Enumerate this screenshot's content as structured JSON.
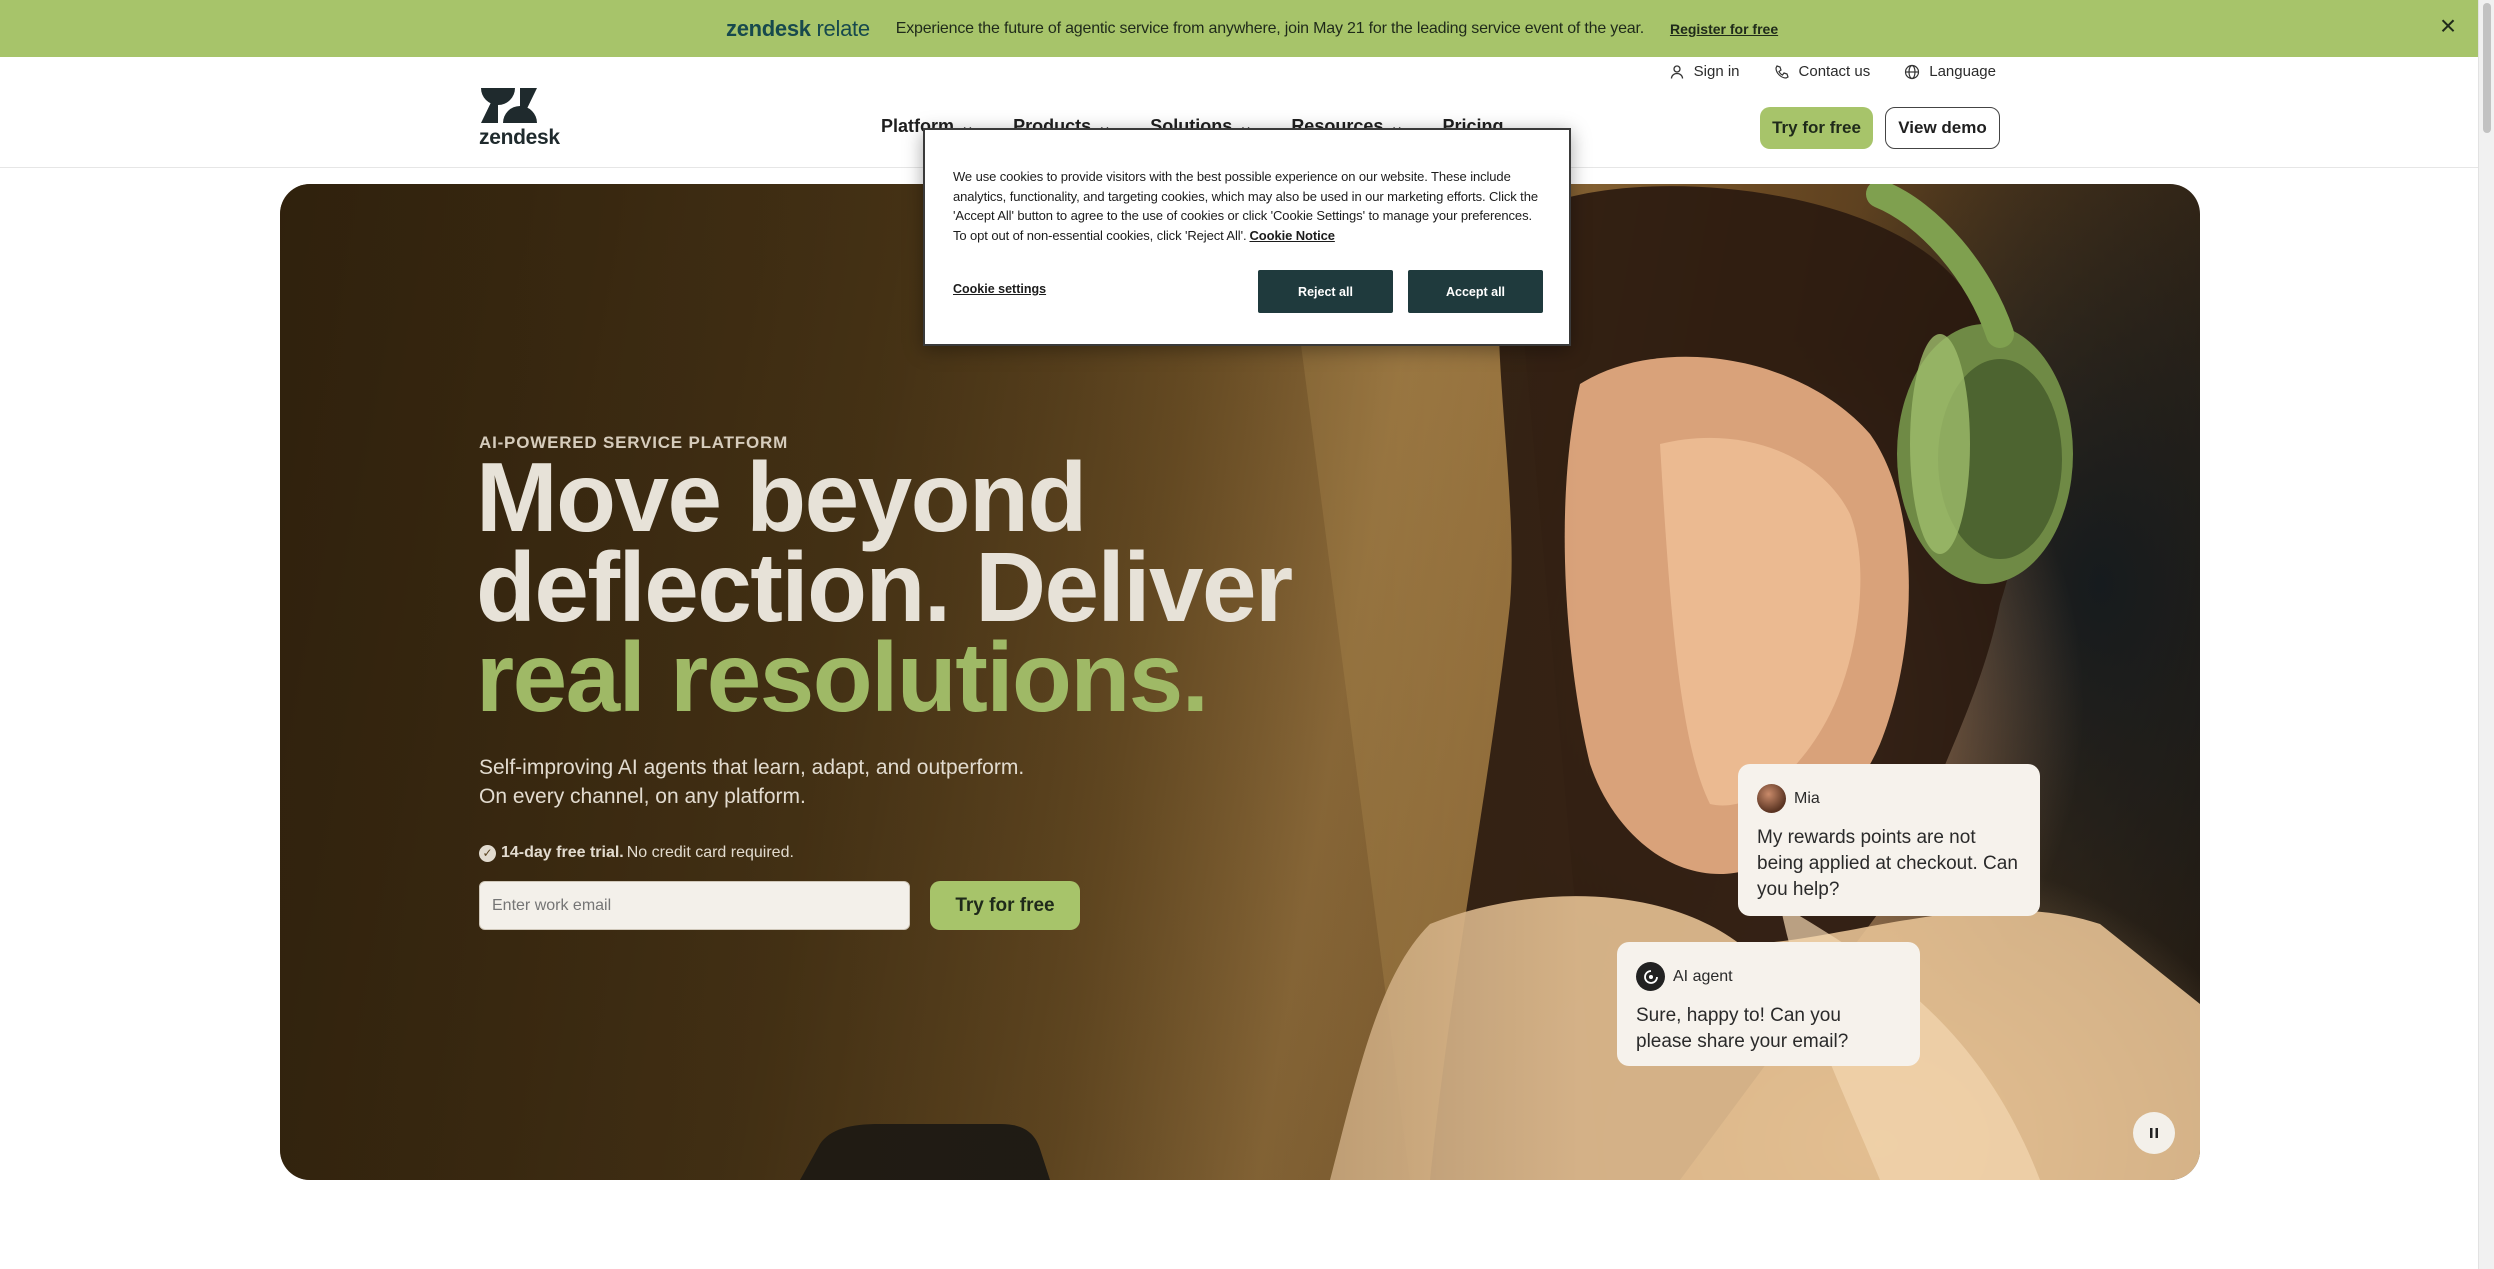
{
  "banner": {
    "brand_bold": "zendesk",
    "brand_light": "relate",
    "message": "Experience the future of agentic service from anywhere, join May 21 for the leading service event of the year.",
    "link": "Register for free",
    "close_icon": "close-icon"
  },
  "utility_nav": {
    "sign_in": "Sign in",
    "contact": "Contact us",
    "language": "Language"
  },
  "header": {
    "logo_text": "zendesk",
    "nav": [
      "Platform",
      "Products",
      "Solutions",
      "Resources",
      "Pricing"
    ],
    "try_free": "Try for free",
    "view_demo": "View demo"
  },
  "hero": {
    "eyebrow": "AI-POWERED SERVICE PLATFORM",
    "headline_line1": "Move beyond",
    "headline_line2": "deflection. Deliver",
    "headline_accent": "real resolutions.",
    "sub_line1": "Self-improving AI agents that learn, adapt, and outperform.",
    "sub_line2": "On every channel, on any platform.",
    "trial_bold": "14-day free trial.",
    "trial_rest": "No credit card required.",
    "email_placeholder": "Enter work email",
    "cta": "Try for free",
    "accent_color": "#9fb966"
  },
  "chat": {
    "mia_name": "Mia",
    "mia_text": "My rewards points are not being applied at checkout. Can you help?",
    "ai_name": "AI agent",
    "ai_text": "Sure, happy to! Can you please share your email?"
  },
  "cookie": {
    "text": "We use cookies to provide visitors with the best possible experience on our website. These include analytics, functionality, and targeting cookies, which may also be used in our marketing efforts. Click the 'Accept All' button to agree to the use of cookies or click 'Cookie Settings' to manage your preferences. To opt out of non-essential cookies, click 'Reject All'.",
    "notice_link": "Cookie Notice",
    "settings": "Cookie settings",
    "reject": "Reject all",
    "accept": "Accept all"
  },
  "colors": {
    "banner_green": "#a7c46a",
    "cookie_button": "#1f3a3d"
  }
}
